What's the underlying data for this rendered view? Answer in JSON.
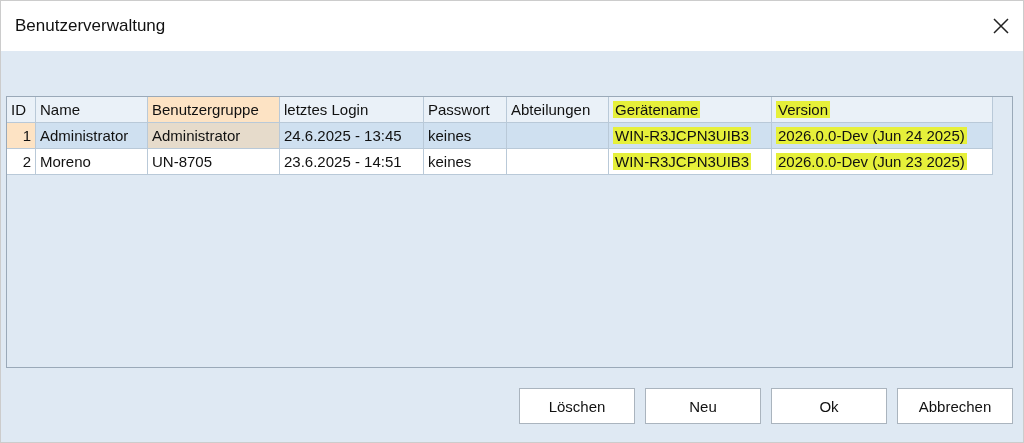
{
  "window": {
    "title": "Benutzerverwaltung"
  },
  "table": {
    "columns": [
      {
        "label": "ID",
        "selected": false,
        "highlighted": false
      },
      {
        "label": "Name",
        "selected": false,
        "highlighted": false
      },
      {
        "label": "Benutzergruppe",
        "selected": true,
        "highlighted": false
      },
      {
        "label": "letztes Login",
        "selected": false,
        "highlighted": false
      },
      {
        "label": "Passwort",
        "selected": false,
        "highlighted": false
      },
      {
        "label": "Abteilungen",
        "selected": false,
        "highlighted": false
      },
      {
        "label": "Gerätename",
        "selected": false,
        "highlighted": true
      },
      {
        "label": "Version",
        "selected": false,
        "highlighted": true
      }
    ],
    "rows": [
      {
        "selected": true,
        "cells": [
          "1",
          "Administrator",
          "Administrator",
          "24.6.2025 - 13:45",
          "keines",
          "",
          "WIN-R3JCPN3UIB3",
          "2026.0.0-Dev (Jun 24 2025)"
        ]
      },
      {
        "selected": false,
        "cells": [
          "2",
          "Moreno",
          "UN-8705",
          "23.6.2025 - 14:51",
          "keines",
          "",
          "WIN-R3JCPN3UIB3",
          "2026.0.0-Dev (Jun 23 2025)"
        ]
      }
    ]
  },
  "buttons": [
    "Löschen",
    "Neu",
    "Ok",
    "Abbrechen"
  ]
}
